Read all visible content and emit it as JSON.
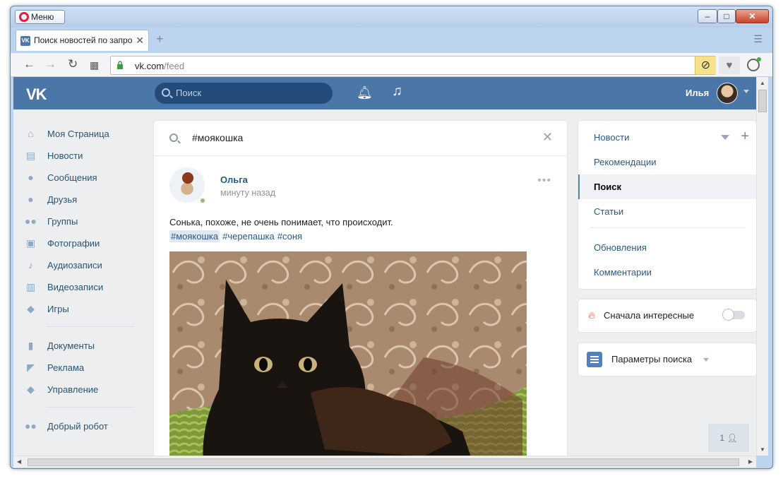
{
  "browser": {
    "menu_label": "Меню",
    "tab_title": "Поиск новостей по запро",
    "tab_favicon": "VK",
    "url_host": "vk.com",
    "url_path": "/feed",
    "win_controls": {
      "min": "–",
      "max": "□",
      "close": "✕"
    }
  },
  "header": {
    "logo": "VK",
    "search_placeholder": "Поиск",
    "user_name": "Илья"
  },
  "left_nav": {
    "items": [
      {
        "label": "Моя Страница",
        "icon": "home-icon"
      },
      {
        "label": "Новости",
        "icon": "news-icon"
      },
      {
        "label": "Сообщения",
        "icon": "messages-icon"
      },
      {
        "label": "Друзья",
        "icon": "friends-icon"
      },
      {
        "label": "Группы",
        "icon": "groups-icon"
      },
      {
        "label": "Фотографии",
        "icon": "camera-icon"
      },
      {
        "label": "Аудиозаписи",
        "icon": "music-icon"
      },
      {
        "label": "Видеозаписи",
        "icon": "film-icon"
      },
      {
        "label": "Игры",
        "icon": "gamepad-icon"
      }
    ],
    "items2": [
      {
        "label": "Документы",
        "icon": "document-icon"
      },
      {
        "label": "Реклама",
        "icon": "megaphone-icon"
      },
      {
        "label": "Управление",
        "icon": "gamepad-icon"
      }
    ],
    "items3": [
      {
        "label": "Добрый робот",
        "icon": "group-icon"
      }
    ]
  },
  "feed": {
    "query": "#моякошка",
    "post": {
      "author": "Ольга",
      "time": "минуту назад",
      "text": "Сонька, похоже, не очень понимает, что происходит.",
      "tags": [
        "#моякошка",
        "#черепашка",
        "#соня"
      ]
    }
  },
  "right_menu": {
    "items": [
      "Новости",
      "Рекомендации",
      "Поиск",
      "Статьи"
    ],
    "items2": [
      "Обновления",
      "Комментарии"
    ],
    "selected": "Поиск"
  },
  "interesting": {
    "label": "Сначала интересные",
    "enabled": false
  },
  "params": {
    "label": "Параметры поиска"
  },
  "chat": {
    "count": "1"
  },
  "colors": {
    "brand": "#4a76a8",
    "link": "#2a5885",
    "bg": "#edeef0"
  }
}
